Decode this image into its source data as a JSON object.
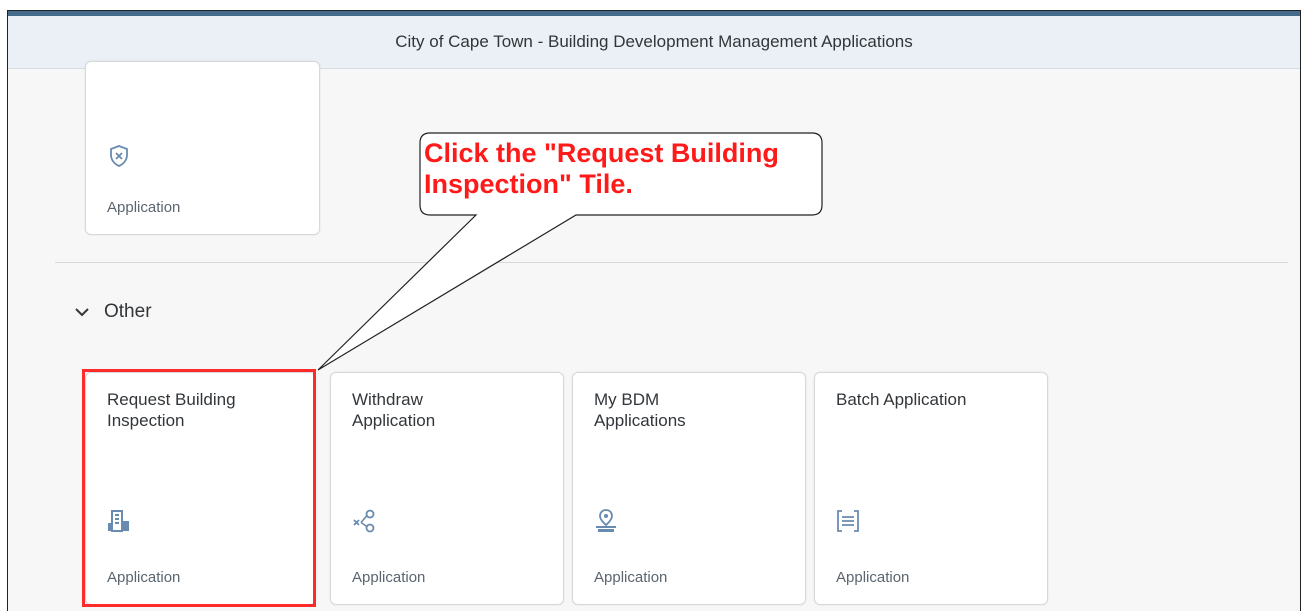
{
  "header": {
    "title": "City of Cape Town - Building Development Management Applications"
  },
  "top_tile": {
    "subtitle": "Application",
    "icon": "shield-x-icon"
  },
  "group": {
    "title": "Other"
  },
  "tiles": [
    {
      "title": "Request Building\nInspection",
      "subtitle": "Application",
      "icon": "building-icon"
    },
    {
      "title": "Withdraw\nApplication",
      "subtitle": "Application",
      "icon": "withdraw-share-icon"
    },
    {
      "title": "My BDM\nApplications",
      "subtitle": "Application",
      "icon": "location-pin-icon"
    },
    {
      "title": "Batch Application",
      "subtitle": "Application",
      "icon": "list-bracket-icon"
    }
  ],
  "callout": {
    "text": "Click the \"Request Building Inspection\" Tile.",
    "color": "#ff1a1a"
  },
  "colors": {
    "accent": "#456b8c",
    "icon": "#6a8bb0",
    "highlight": "#ff2a2a"
  }
}
